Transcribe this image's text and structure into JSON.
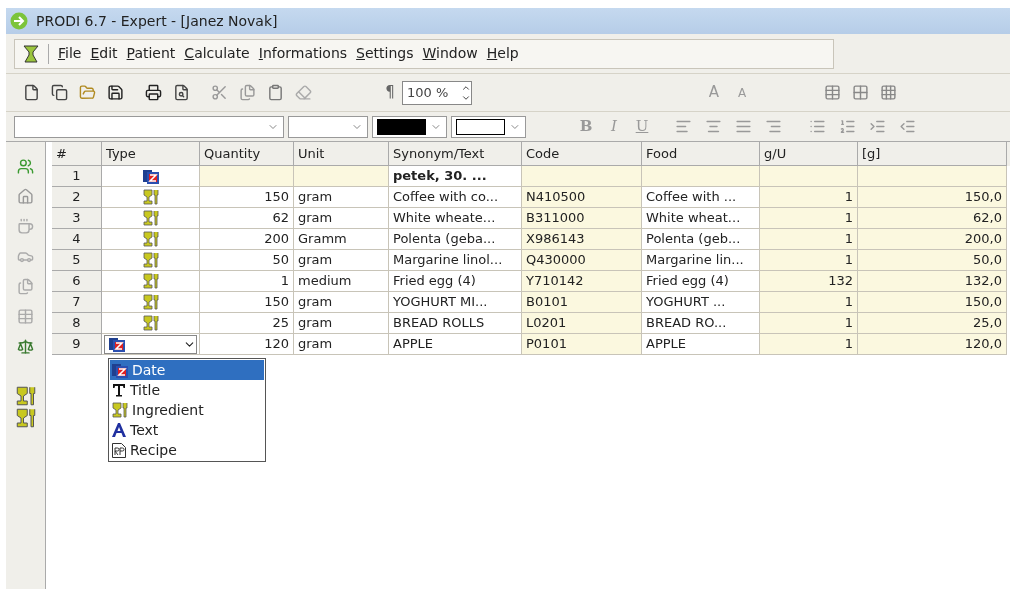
{
  "window": {
    "title": "PRODI 6.7 - Expert - [Janez Novak]"
  },
  "menu": [
    "File",
    "Edit",
    "Patient",
    "Calculate",
    "Informations",
    "Settings",
    "Window",
    "Help"
  ],
  "toolbar": {
    "pilcrow": "¶",
    "zoom": "100 %",
    "font_glyphs": [
      "A",
      "A"
    ]
  },
  "format_bar": {
    "style_buttons": [
      {
        "label": "B",
        "kind": "bold"
      },
      {
        "label": "I",
        "kind": "italic"
      },
      {
        "label": "U",
        "kind": "underline"
      }
    ]
  },
  "table": {
    "columns": [
      "#",
      "Type",
      "Quantity",
      "Unit",
      "Synonym/Text",
      "Code",
      "Food",
      "g/U",
      "[g]"
    ],
    "rows": [
      {
        "n": "1",
        "kind": "date",
        "text": "petek, 30. ..."
      },
      {
        "n": "2",
        "kind": "ingredient",
        "quantity": "150",
        "unit": "gram",
        "text": "Coffee with co...",
        "code": "N410500",
        "food": "Coffee with ...",
        "g_u": "1",
        "grams": "150,0"
      },
      {
        "n": "3",
        "kind": "ingredient",
        "quantity": "62",
        "unit": "gram",
        "text": "White wheate...",
        "code": "B311000",
        "food": "White wheat...",
        "g_u": "1",
        "grams": "62,0"
      },
      {
        "n": "4",
        "kind": "ingredient",
        "quantity": "200",
        "unit": "Gramm",
        "text": "Polenta (geba...",
        "code": "X986143",
        "food": "Polenta (geb...",
        "g_u": "1",
        "grams": "200,0"
      },
      {
        "n": "5",
        "kind": "ingredient",
        "quantity": "50",
        "unit": "gram",
        "text": "Margarine linol...",
        "code": "Q430000",
        "food": "Margarine lin...",
        "g_u": "1",
        "grams": "50,0"
      },
      {
        "n": "6",
        "kind": "ingredient",
        "quantity": "1",
        "unit": "medium",
        "text": "Fried egg (4)",
        "code": "Y710142",
        "food": "Fried egg (4)",
        "g_u": "132",
        "grams": "132,0"
      },
      {
        "n": "7",
        "kind": "ingredient",
        "quantity": "150",
        "unit": "gram",
        "text": "YOGHURT MI...",
        "code": "B0101",
        "food": "YOGHURT ...",
        "g_u": "1",
        "grams": "150,0"
      },
      {
        "n": "8",
        "kind": "ingredient",
        "quantity": "25",
        "unit": "gram",
        "text": "BREAD ROLLS",
        "code": "L0201",
        "food": "BREAD RO...",
        "g_u": "1",
        "grams": "25,0"
      },
      {
        "n": "9",
        "kind": "editing",
        "quantity": "120",
        "unit": "gram",
        "text": "APPLE",
        "code": "P0101",
        "food": "APPLE",
        "g_u": "1",
        "grams": "120,0"
      }
    ]
  },
  "type_dropdown": {
    "items": [
      {
        "label": "Date",
        "kind": "date",
        "selected": true
      },
      {
        "label": "Title",
        "kind": "title",
        "selected": false
      },
      {
        "label": "Ingredient",
        "kind": "ingredient",
        "selected": false
      },
      {
        "label": "Text",
        "kind": "text",
        "selected": false
      },
      {
        "label": "Recipe",
        "kind": "recipe",
        "selected": false
      }
    ]
  }
}
